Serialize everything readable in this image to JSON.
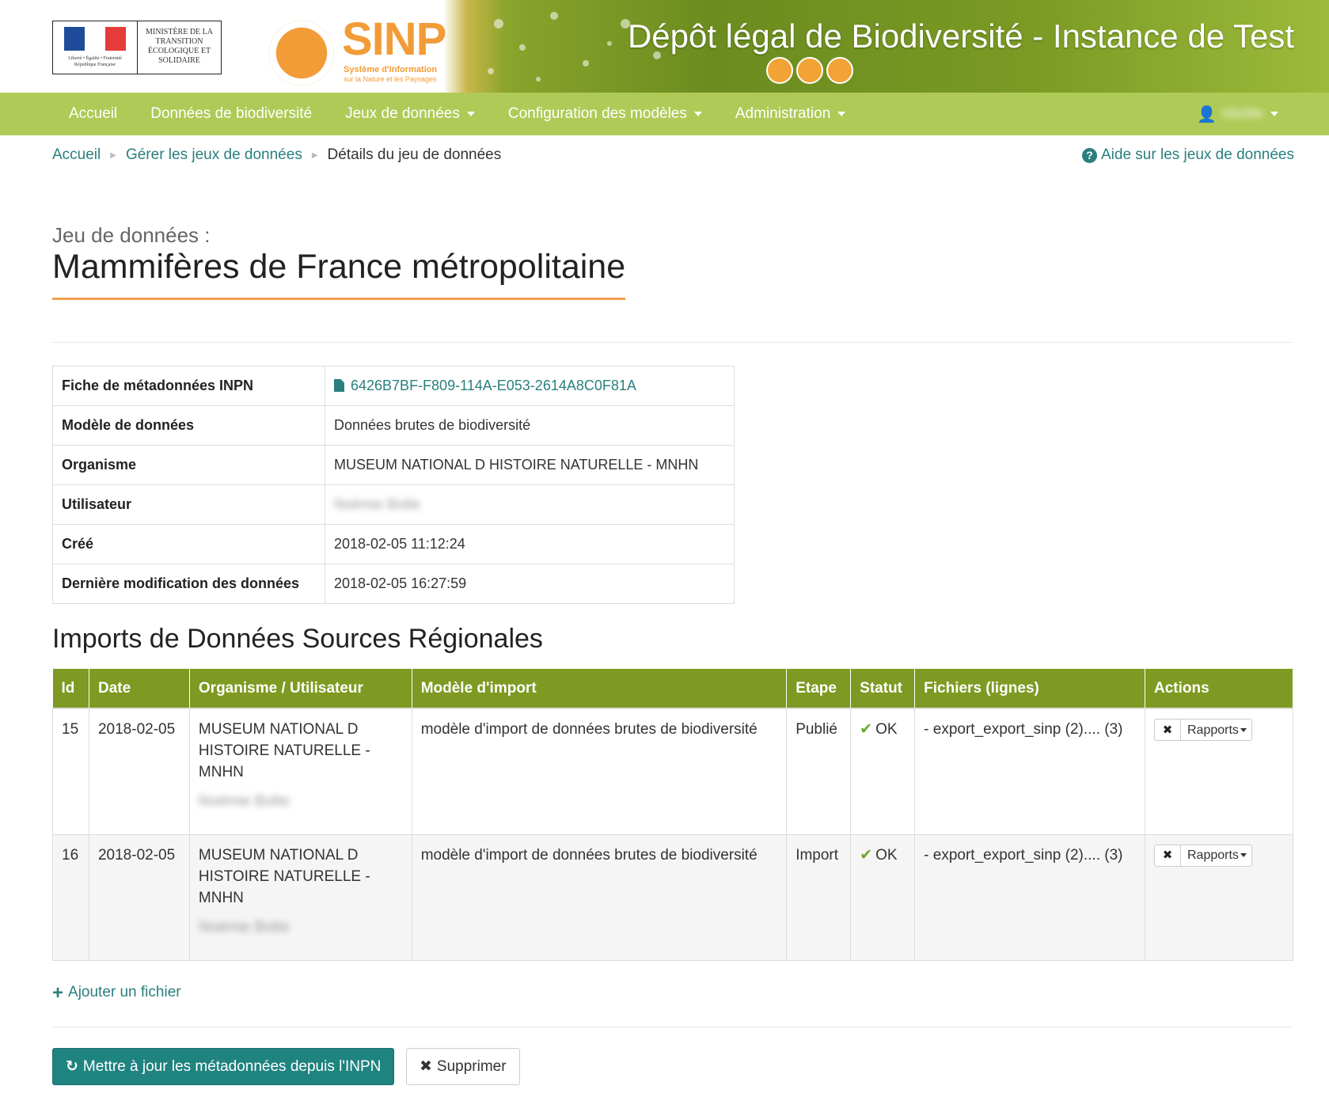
{
  "header": {
    "ministry_text": "Ministère de la transition écologique et solidaire",
    "motto": "Liberté • Égalité • Fraternité",
    "republic": "République Française",
    "sinp_title": "SINP",
    "sinp_subtitle": "Système d'Information",
    "sinp_subtitle2": "sur la Nature et les Paysages",
    "app_title": "Dépôt légal de Biodiversité - Instance de Test"
  },
  "nav": {
    "items": [
      {
        "label": "Accueil",
        "has_caret": false
      },
      {
        "label": "Données de biodiversité",
        "has_caret": false
      },
      {
        "label": "Jeux de données",
        "has_caret": true
      },
      {
        "label": "Configuration des modèles",
        "has_caret": true
      },
      {
        "label": "Administration",
        "has_caret": true
      }
    ],
    "user_label": "nbotte"
  },
  "breadcrumb": {
    "items": [
      "Accueil",
      "Gérer les jeux de données"
    ],
    "current": "Détails du jeu de données"
  },
  "help_link": "Aide sur les jeux de données",
  "dataset": {
    "label": "Jeu de données :",
    "title": "Mammifères de France métropolitaine"
  },
  "metadata": [
    {
      "key": "Fiche de métadonnées INPN",
      "value": "6426B7BF-F809-114A-E053-2614A8C0F81A"
    },
    {
      "key": "Modèle de données",
      "value": "Données brutes de biodiversité"
    },
    {
      "key": "Organisme",
      "value": "MUSEUM NATIONAL D HISTOIRE NATURELLE - MNHN"
    },
    {
      "key": "Utilisateur",
      "value": "Noémie Botte"
    },
    {
      "key": "Créé",
      "value": "2018-02-05 11:12:24"
    },
    {
      "key": "Dernière modification des données",
      "value": "2018-02-05 16:27:59"
    }
  ],
  "imports_section": {
    "title": "Imports de Données Sources Régionales",
    "columns": [
      "Id",
      "Date",
      "Organisme / Utilisateur",
      "Modèle d'import",
      "Etape",
      "Statut",
      "Fichiers (lignes)",
      "Actions"
    ],
    "rows": [
      {
        "id": "15",
        "date": "2018-02-05",
        "org": "MUSEUM NATIONAL D HISTOIRE NATURELLE - MNHN",
        "user": "Noémie Botte",
        "model": "modèle d'import de données brutes de biodiversité",
        "step": "Publié",
        "status": "OK",
        "files": "- export_export_sinp (2).... (3)",
        "reports_label": "Rapports"
      },
      {
        "id": "16",
        "date": "2018-02-05",
        "org": "MUSEUM NATIONAL D HISTOIRE NATURELLE - MNHN",
        "user": "Noémie Botte",
        "model": "modèle d'import de données brutes de biodiversité",
        "step": "Import",
        "status": "OK",
        "files": "- export_export_sinp (2).... (3)",
        "reports_label": "Rapports"
      }
    ]
  },
  "add_file_label": "Ajouter un fichier",
  "buttons": {
    "update": "Mettre à jour les métadonnées depuis l'INPN",
    "delete": "Supprimer"
  },
  "colors": {
    "navbar": "#b0ca57",
    "table_header": "#7f9a22",
    "link": "#2a7f7f",
    "accent": "#f0a04a",
    "primary_button": "#1f8380"
  }
}
